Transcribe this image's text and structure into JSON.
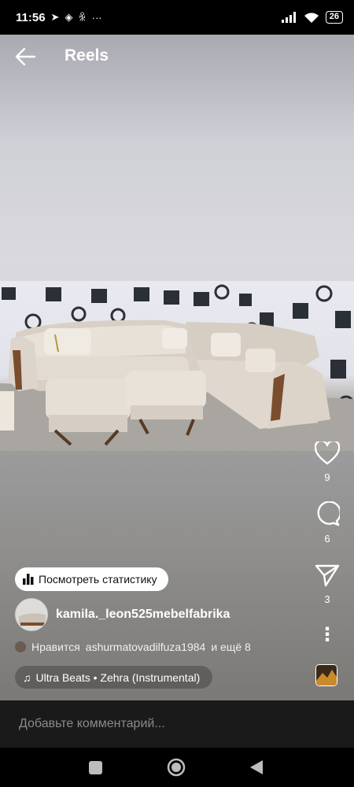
{
  "status_bar": {
    "time": "11:56",
    "notification_icons": [
      "telegram-icon",
      "vpn-icon",
      "odnoklassniki-icon"
    ],
    "more_dots": "···",
    "battery": "26"
  },
  "header": {
    "title": "Reels"
  },
  "actions": {
    "like_count": "9",
    "comment_count": "6",
    "share_count": "3",
    "more_glyph": "⋮"
  },
  "post": {
    "stats_label": "Посмотреть статистику",
    "username": "kamila._leon525mebelfabrika",
    "likes_prefix": "Нравится",
    "likes_user": "ashurmatovadilfuza1984",
    "likes_suffix": "и ещё 8",
    "music": "Ultra Beats • Zehra (Instrumental)"
  },
  "comment": {
    "placeholder": "Добавьте комментарий..."
  },
  "colors": {
    "status_bar_bg": "#000000",
    "comment_bar_bg": "#1a1a1a",
    "pill_bg": "#ffffff"
  }
}
